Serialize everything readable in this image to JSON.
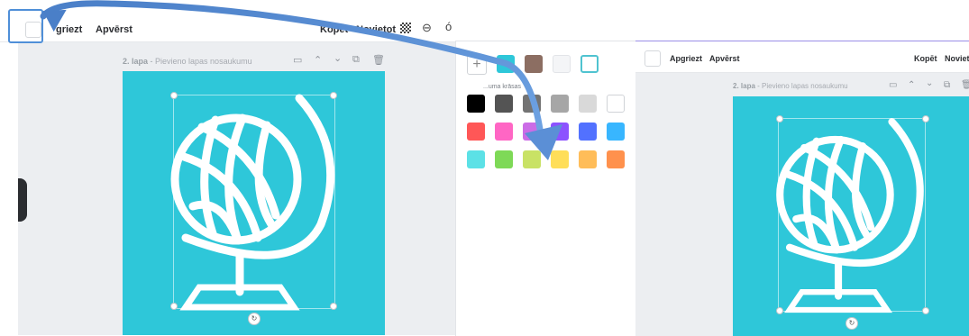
{
  "left": {
    "toolbar": {
      "crop_label": "Apgriezt",
      "crop_label_visible": "griezt",
      "flip_label": "Apvērst",
      "copy_label": "Kopēt",
      "position_label": "Novietot"
    },
    "page": {
      "number": "2. lapa",
      "separator": " - ",
      "title_placeholder": "Pievieno lapas nosaukumu"
    }
  },
  "palette": {
    "doc_colors": [
      "#2ec7d9",
      "#8c6e62",
      "#f4f5f7",
      "#ffffff"
    ],
    "default_label": "...uma krāsas",
    "default_rows": [
      [
        "#000000",
        "#545454",
        "#737373",
        "#a6a6a6",
        "#d9d9d9",
        "#ffffff"
      ],
      [
        "#ff5757",
        "#ff66c4",
        "#cb6ce6",
        "#8c52ff",
        "#5271ff",
        "#38b6ff"
      ],
      [
        "#5ce1e6",
        "#7ed957",
        "#c9e265",
        "#ffde59",
        "#ffbd59",
        "#ff914d"
      ]
    ]
  },
  "right": {
    "toolbar": {
      "crop_label": "Apgriezt",
      "flip_label": "Apvērst",
      "copy_label": "Kopēt",
      "position_label": "Noviet"
    },
    "page": {
      "number": "2. lapa",
      "separator": " - ",
      "title_placeholder": "Pievieno lapas nosaukumu"
    }
  },
  "colors": {
    "canvas": "#2ec7d9",
    "arrow": "#5b8fd6",
    "highlight": "#4f8fd8"
  },
  "icons": [
    "globe-graphic",
    "comment-icon",
    "chevron-up-icon",
    "chevron-down-icon",
    "duplicate-icon",
    "trash-icon",
    "transparency-icon",
    "link-icon",
    "rotate-icon",
    "plus-icon"
  ]
}
